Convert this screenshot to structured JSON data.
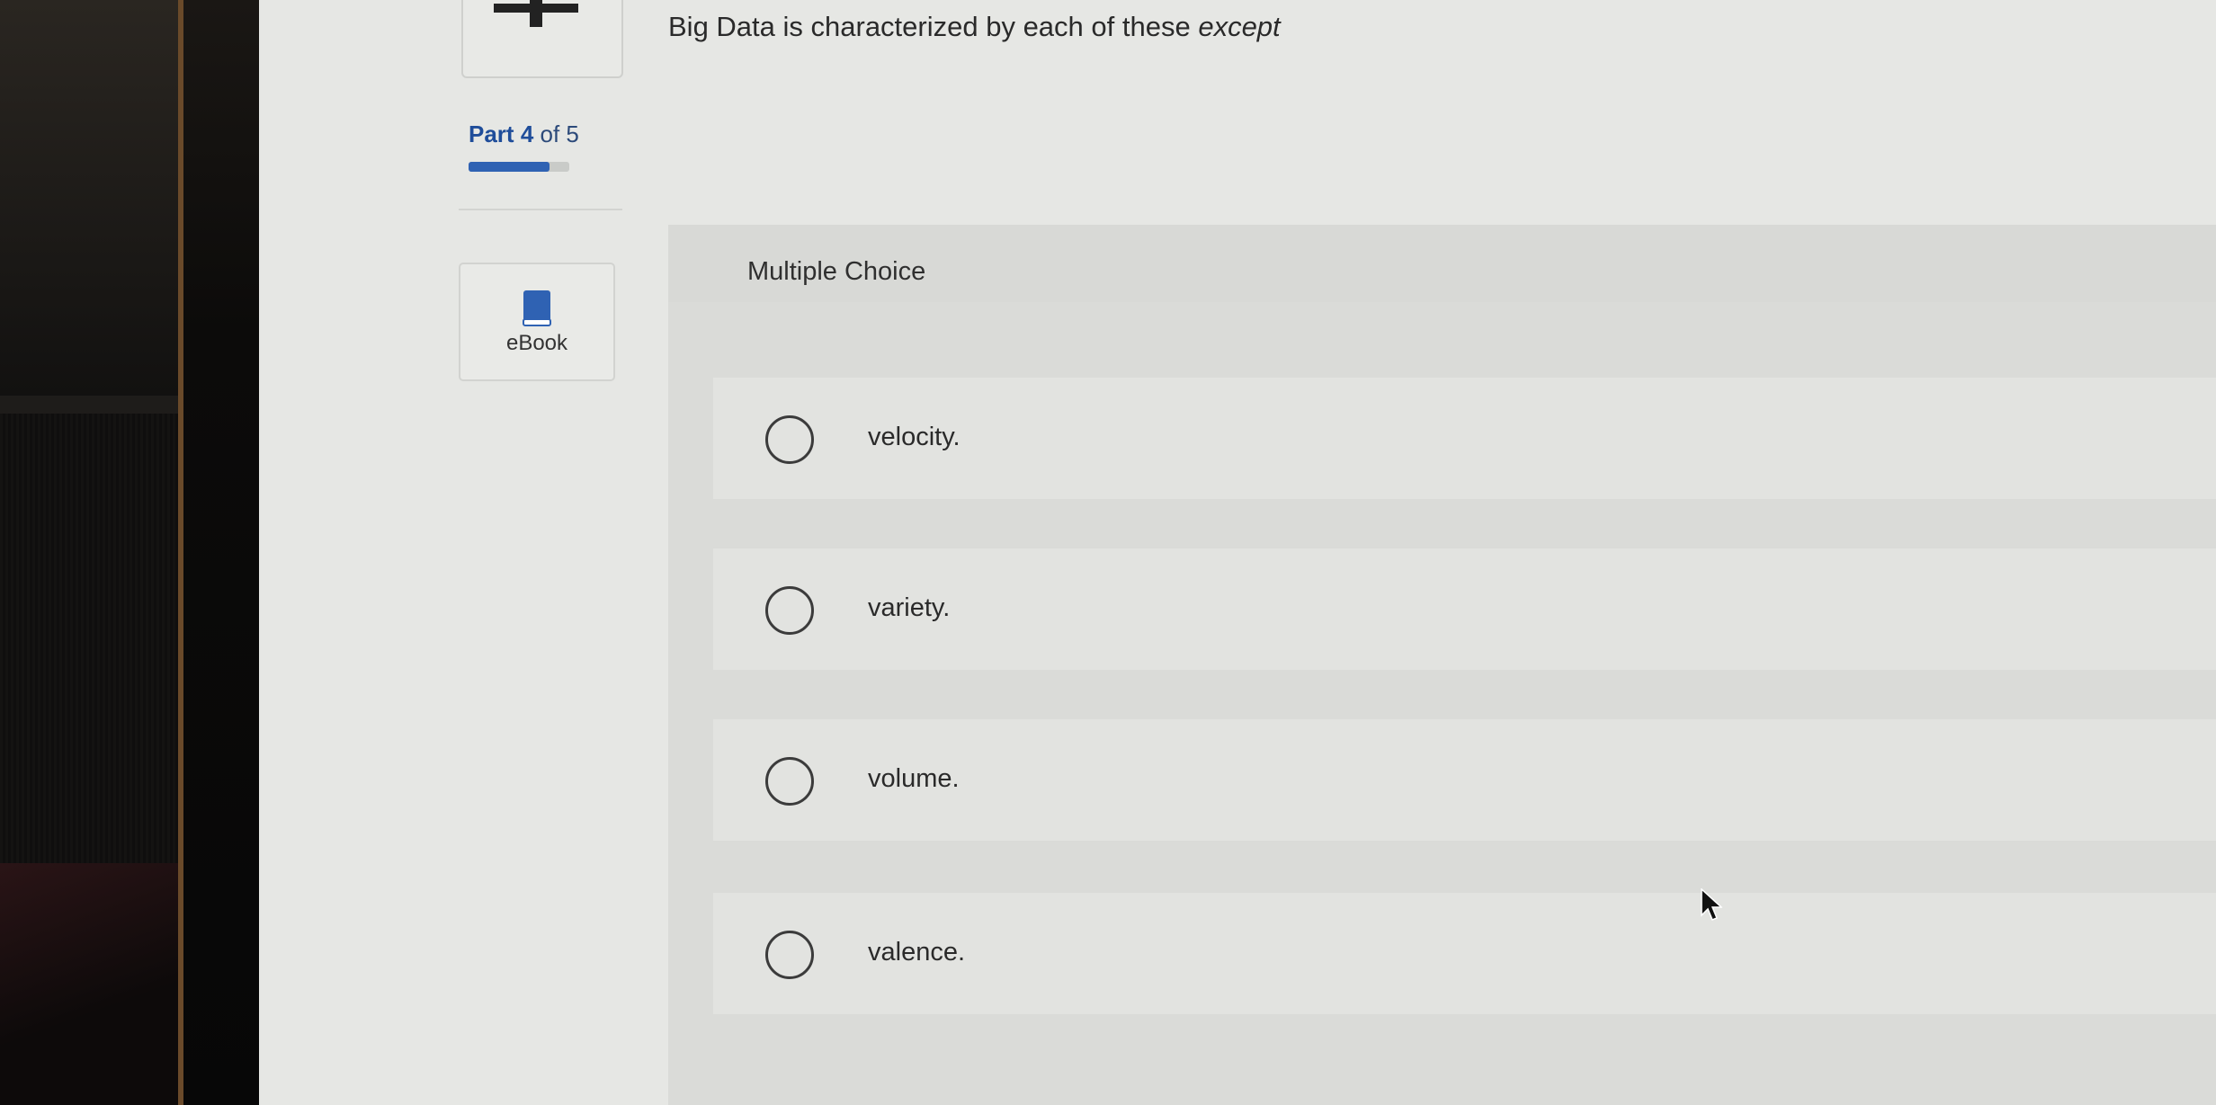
{
  "question": {
    "text": "Big Data is characterized by each of these ",
    "emphasis": "except"
  },
  "progress": {
    "prefix": "Part ",
    "current": "4",
    "separator": " of ",
    "total": "5",
    "fraction": 0.8
  },
  "sidebar": {
    "ebook_label": "eBook",
    "ebook_icon": "book-icon"
  },
  "question_type": "Multiple Choice",
  "options": [
    {
      "label": "velocity.",
      "selected": false
    },
    {
      "label": "variety.",
      "selected": false
    },
    {
      "label": "volume.",
      "selected": false
    },
    {
      "label": "valence.",
      "selected": false
    }
  ],
  "colors": {
    "accent": "#2f62b3",
    "link": "#1f4d9a",
    "page_bg": "#e6e7e4"
  }
}
